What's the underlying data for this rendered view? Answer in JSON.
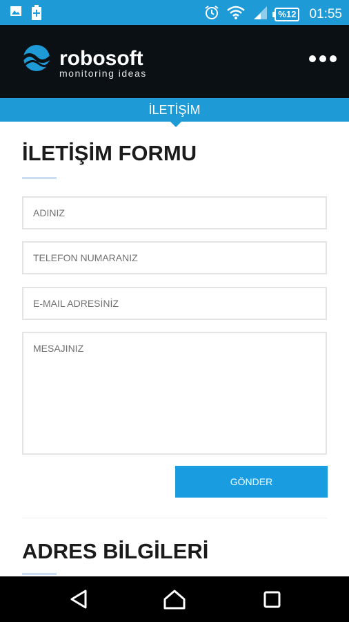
{
  "status_bar": {
    "battery_text": "%12",
    "time": "01:55",
    "icons": [
      "image-icon",
      "battery-charging-icon",
      "alarm-icon",
      "wifi-icon",
      "signal-icon"
    ]
  },
  "header": {
    "logo_name": "robosoft",
    "logo_tagline": "monitoring ideas",
    "menu_icon": "overflow-menu-icon"
  },
  "tab": {
    "label": "İLETİŞİM"
  },
  "contact_form": {
    "title": "İLETİŞİM FORMU",
    "fields": {
      "name_placeholder": "ADINIZ",
      "phone_placeholder": "TELEFON NUMARANIZ",
      "email_placeholder": "E-MAIL ADRESİNİZ",
      "message_placeholder": "MESAJINIZ"
    },
    "submit_label": "GÖNDER"
  },
  "address": {
    "title": "ADRES BİLGİLERİ"
  },
  "nav_bar": {
    "icons": [
      "back-icon",
      "home-icon",
      "recents-icon"
    ]
  },
  "colors": {
    "accent": "#1e9ad6",
    "header_bg": "#0b1014"
  }
}
